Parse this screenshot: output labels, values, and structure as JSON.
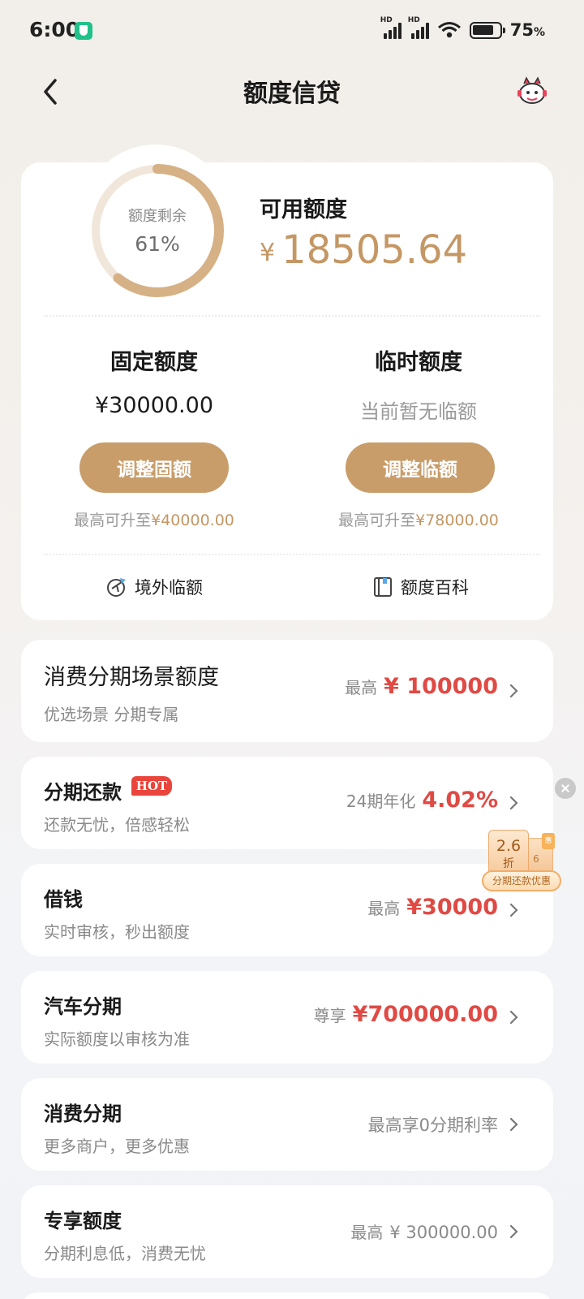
{
  "status_bar": {
    "time": "6:00",
    "network_1": "HD",
    "network_2": "HD",
    "battery": "75",
    "battery_unit": "%"
  },
  "nav": {
    "title": "额度信贷"
  },
  "quota": {
    "ring_label": "额度剩余",
    "ring_percent_text": "61%",
    "remaining_fraction": 0.61,
    "available_title": "可用额度",
    "currency": "¥",
    "available_amount": "18505.64",
    "fixed": {
      "title": "固定额度",
      "value": "¥30000.00",
      "button": "调整固额",
      "note_prefix": "最高可升至",
      "note_amount": "¥40000.00"
    },
    "temp": {
      "title": "临时额度",
      "value": "当前暂无临额",
      "button": "调整临额",
      "note_prefix": "最高可升至",
      "note_amount": "¥78000.00"
    },
    "links": {
      "overseas": "境外临额",
      "wiki": "额度百科"
    }
  },
  "items": [
    {
      "title": "消费分期场景额度",
      "subtitle": "优选场景 分期专属",
      "prefix": "最高",
      "value": "¥ 100000"
    },
    {
      "title": "分期还款",
      "badge": "HOT",
      "subtitle": "还款无忧，倍感轻松",
      "prefix": "24期年化",
      "value": "4.02%"
    },
    {
      "title": "借钱",
      "subtitle": "实时审核，秒出额度",
      "prefix": "最高",
      "value": "¥30000"
    },
    {
      "title": "汽车分期",
      "subtitle": "实际额度以审核为准",
      "prefix": "尊享",
      "value": "¥700000.00"
    },
    {
      "title": "消费分期",
      "subtitle": "更多商户，更多优惠",
      "value": "最高享0分期利率"
    },
    {
      "title": "专享额度",
      "subtitle": "分期利息低，消费无忧",
      "prefix": "最高",
      "value": "¥ 300000.00"
    }
  ],
  "promo": {
    "discount": "2.6",
    "discount_unit": "折",
    "back_num": "6",
    "mini": "惠",
    "label": "分期还款优惠"
  },
  "colors": {
    "gold": "#c49764",
    "button": "#c89d6a",
    "red": "#e04a44",
    "ring_track": "#f1e6da"
  }
}
